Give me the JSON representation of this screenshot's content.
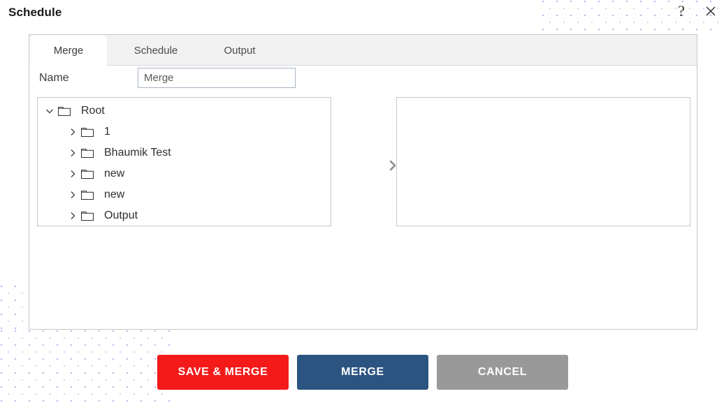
{
  "window": {
    "title": "Schedule",
    "help_icon": "question-mark-icon",
    "close_icon": "close-icon"
  },
  "tabs": [
    {
      "label": "Merge",
      "active": true
    },
    {
      "label": "Schedule",
      "active": false
    },
    {
      "label": "Output",
      "active": false
    }
  ],
  "form": {
    "name_label": "Name",
    "name_value": "Merge",
    "name_placeholder": "Merge"
  },
  "source_tree": {
    "nodes": [
      {
        "label": "Root",
        "expanded": true,
        "level": 0,
        "icon": "folder-icon",
        "chevron": "chevron-down-icon"
      },
      {
        "label": "1",
        "expanded": false,
        "level": 1,
        "icon": "folder-icon",
        "chevron": "chevron-right-icon"
      },
      {
        "label": "Bhaumik Test",
        "expanded": false,
        "level": 1,
        "icon": "folder-icon",
        "chevron": "chevron-right-icon"
      },
      {
        "label": "new",
        "expanded": false,
        "level": 1,
        "icon": "folder-icon",
        "chevron": "chevron-right-icon"
      },
      {
        "label": "new",
        "expanded": false,
        "level": 1,
        "icon": "folder-icon",
        "chevron": "chevron-right-icon"
      },
      {
        "label": "Output",
        "expanded": false,
        "level": 1,
        "icon": "folder-icon",
        "chevron": "chevron-right-icon"
      }
    ]
  },
  "destination": {
    "items": []
  },
  "move_button": {
    "icon": "chevron-right-icon"
  },
  "footer": {
    "save_merge_label": "SAVE & MERGE",
    "merge_label": "MERGE",
    "cancel_label": "CANCEL"
  },
  "colors": {
    "save_merge_bg": "#f41a1a",
    "merge_bg": "#2b5480",
    "cancel_bg": "#999999",
    "panel_border": "#c8c8c8",
    "tabbar_bg": "#f2f2f2",
    "pattern_dot": "#b8bde8"
  }
}
